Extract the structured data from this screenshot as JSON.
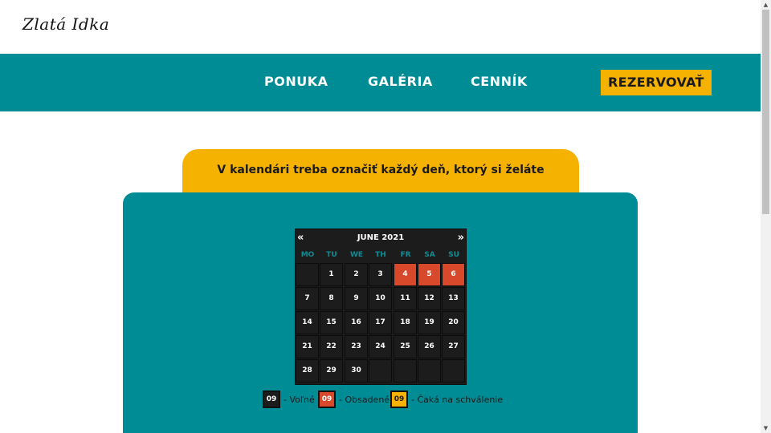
{
  "logo": "Zlatá Idka",
  "nav": {
    "items": [
      "PONUKA",
      "GALÉRIA",
      "CENNÍK"
    ],
    "reserve": "REZERVOVAŤ"
  },
  "instruction": "V kalendári treba označiť každý deň, ktorý si želáte rezervovať",
  "calendar": {
    "month_label": "JUNE 2021",
    "prev": "«",
    "next": "»",
    "weekdays": [
      "MO",
      "TU",
      "WE",
      "TH",
      "FR",
      "SA",
      "SU"
    ],
    "weeks": [
      [
        "",
        "1",
        "2",
        "3",
        "4",
        "5",
        "6"
      ],
      [
        "7",
        "8",
        "9",
        "10",
        "11",
        "12",
        "13"
      ],
      [
        "14",
        "15",
        "16",
        "17",
        "18",
        "19",
        "20"
      ],
      [
        "21",
        "22",
        "23",
        "24",
        "25",
        "26",
        "27"
      ],
      [
        "28",
        "29",
        "30",
        "",
        "",
        "",
        ""
      ]
    ],
    "occupied_days": [
      "4",
      "5",
      "6"
    ]
  },
  "legend": [
    {
      "sample": "09",
      "label": "- Voľné",
      "status": "free"
    },
    {
      "sample": "09",
      "label": "- Obsadené",
      "status": "busy"
    },
    {
      "sample": "09",
      "label": "- Čaká na schválenie",
      "status": "pending"
    }
  ],
  "colors": {
    "teal": "#008c95",
    "yellow": "#f5b200",
    "busy": "#d8492b",
    "free": "#1c1c1c"
  }
}
